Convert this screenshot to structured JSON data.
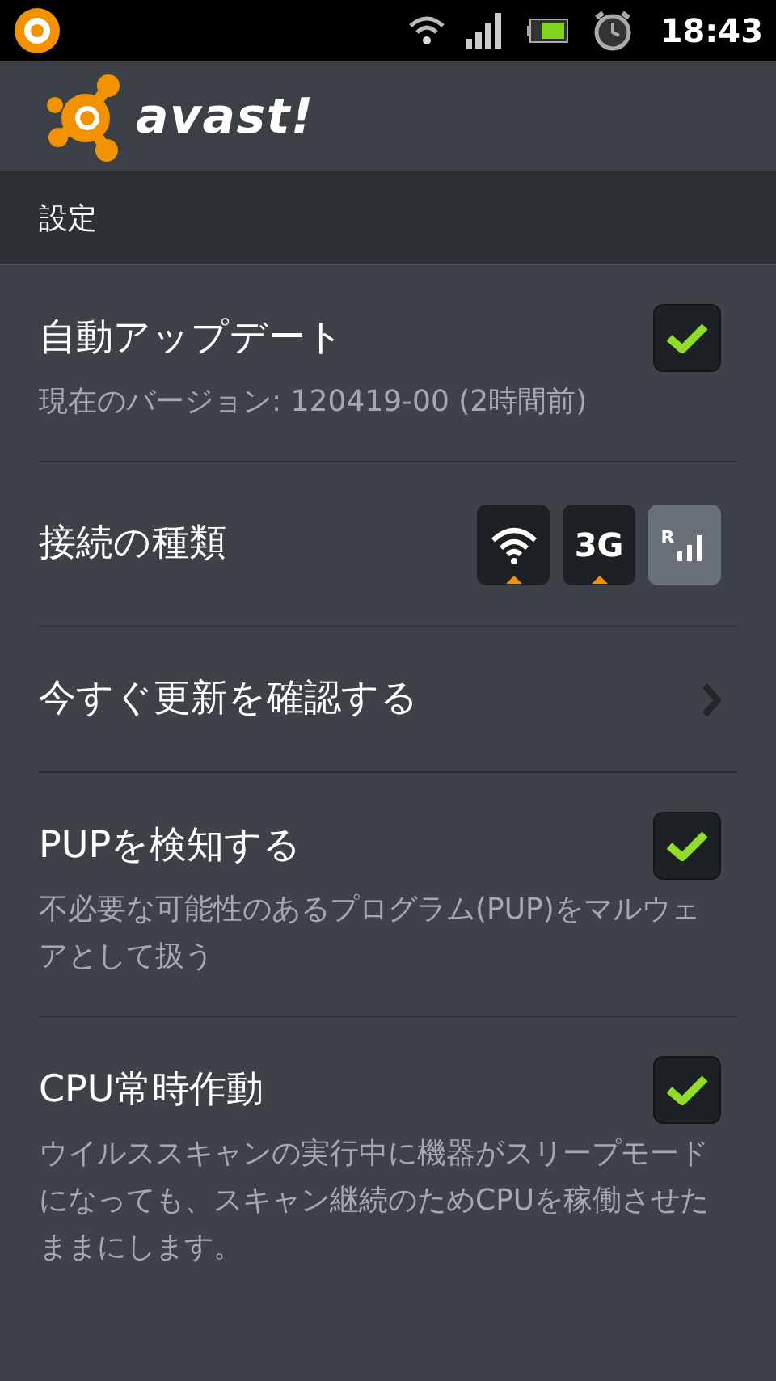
{
  "status_bar": {
    "time": "18:43"
  },
  "header": {
    "logo_text": "avast!"
  },
  "section_title": "設定",
  "settings": [
    {
      "kind": "checkbox",
      "title": "自動アップデート",
      "subtitle": "現在のバージョン: 120419-00 (2時間前)",
      "checked": true
    },
    {
      "kind": "connection",
      "title": "接続の種類",
      "toggles": [
        {
          "kind": "wifi",
          "selected": true
        },
        {
          "kind": "mobile",
          "label": "3G",
          "selected": true
        },
        {
          "kind": "roaming",
          "label": "R",
          "selected": false
        }
      ]
    },
    {
      "kind": "link",
      "title": "今すぐ更新を確認する"
    },
    {
      "kind": "checkbox",
      "title": "PUPを検知する",
      "subtitle": "不必要な可能性のあるプログラム(PUP)をマルウェアとして扱う",
      "checked": true
    },
    {
      "kind": "checkbox",
      "title": "CPU常時作動",
      "subtitle": "ウイルススキャンの実行中に機器がスリープモードになっても、スキャン継続のためCPUを稼働させたままにします。",
      "checked": true
    }
  ]
}
